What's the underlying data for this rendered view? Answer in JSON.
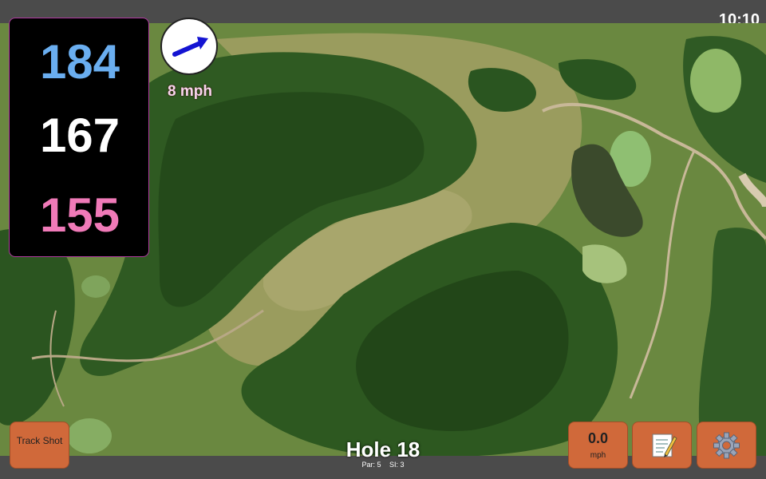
{
  "status_bar": {
    "time": "10:10"
  },
  "distances": {
    "back": "184",
    "middle": "167",
    "front": "155"
  },
  "wind": {
    "speed_label": "8 mph",
    "direction_icon": "arrow-northeast-icon"
  },
  "hole": {
    "title": "Hole 18",
    "par": "Par: 5",
    "si": "SI: 3"
  },
  "buttons": {
    "track_shot": "Track Shot",
    "wind_value": "0.0",
    "wind_unit": "mph",
    "notes_icon": "memo-icon",
    "settings_icon": "gear-icon"
  },
  "colors": {
    "button": "#d0693a",
    "back": "#6aaef0",
    "middle": "#ffffff",
    "front": "#f07ab8",
    "arrow": "#1414d2"
  }
}
